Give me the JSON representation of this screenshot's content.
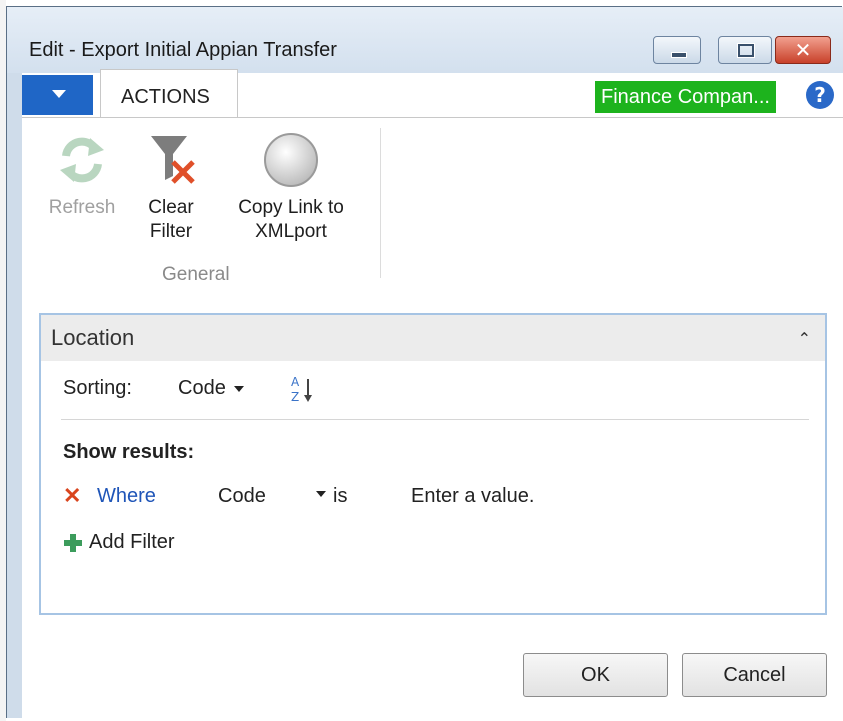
{
  "window": {
    "title": "Edit - Export Initial Appian Transfer",
    "controls": [
      "minimize-icon",
      "maximize-icon",
      "close-icon"
    ]
  },
  "ribbon": {
    "tabs": [
      {
        "label": "ACTIONS",
        "active": true
      }
    ],
    "company": "Finance Compan...",
    "company_color": "#1db31d",
    "groups": [
      {
        "label": "General",
        "items": [
          {
            "label": "Refresh",
            "icon": "refresh-icon",
            "enabled": false
          },
          {
            "label": "Clear Filter",
            "label_line1": "Clear",
            "label_line2": "Filter",
            "icon": "clear-filter-icon",
            "enabled": true
          },
          {
            "label": "Copy Link to XMLport",
            "label_line1": "Copy Link to",
            "label_line2": "XMLport",
            "icon": "link-circle-icon",
            "enabled": true
          }
        ]
      }
    ]
  },
  "panel": {
    "title": "Location",
    "sorting_label": "Sorting:",
    "sorting_value": "Code",
    "show_results_label": "Show results:",
    "filter": {
      "keyword": "Where",
      "field": "Code",
      "operator": "is",
      "value_placeholder": "Enter a value."
    },
    "add_filter_label": "Add Filter"
  },
  "buttons": {
    "ok": "OK",
    "cancel": "Cancel"
  },
  "colors": {
    "accent": "#1f66c6",
    "panel_border": "#a6c4e4",
    "where_link": "#1f55b8",
    "remove_x": "#d9451e"
  }
}
